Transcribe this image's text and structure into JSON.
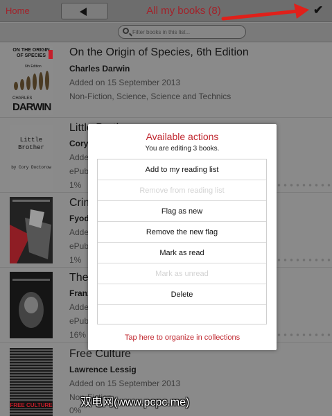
{
  "topbar": {
    "home_label": "Home",
    "title": "All my books (8)",
    "check_icon": "✔"
  },
  "search": {
    "placeholder": "Filter books in this list..."
  },
  "books": [
    {
      "title": "On the Origin of Species, 6th Edition",
      "author": "Charles Darwin",
      "added": "Added on 15 September 2013",
      "meta": "Non-Fiction, Science, Science and Technics",
      "cover_title": "ON THE ORIGIN OF SPECIES",
      "cover_edition": "6th Edition",
      "cover_name_small": "CHARLES",
      "cover_name_big": "DARWIN"
    },
    {
      "title": "Little Brother",
      "author": "Cory Doctorow",
      "added": "Added on 15 September 2013",
      "meta": "ePub",
      "progress": "1%",
      "cover_title": "Little Brother",
      "cover_by": "by Cory Doctorow"
    },
    {
      "title": "Crime and Punishment",
      "author": "Fyodor Dostoyevsky",
      "added": "Added on 15 September 2013",
      "meta": "ePub",
      "progress": "1%"
    },
    {
      "title": "The Metamorphosis",
      "author": "Franz Kafka",
      "added": "Added on 15 September 2013",
      "meta": "ePub",
      "progress": "16%"
    },
    {
      "title": "Free Culture",
      "author": "Lawrence Lessig",
      "added": "Added on 15 September 2013",
      "meta": "Non-Fiction",
      "progress": "0%",
      "cover_title": "FREE CULTURE"
    }
  ],
  "modal": {
    "title": "Available actions",
    "subtitle": "You are editing 3 books.",
    "actions": [
      {
        "label": "Add to my reading list",
        "enabled": true
      },
      {
        "label": "Remove from reading list",
        "enabled": false
      },
      {
        "label": "Flag as new",
        "enabled": true
      },
      {
        "label": "Remove the new flag",
        "enabled": true
      },
      {
        "label": "Mark as read",
        "enabled": true
      },
      {
        "label": "Mark as unread",
        "enabled": false
      },
      {
        "label": "Delete",
        "enabled": true
      },
      {
        "label": "",
        "enabled": false
      }
    ],
    "collections_link": "Tap here to organize in collections"
  },
  "watermark": "双电网(www.pcpc.me)",
  "colors": {
    "accent": "#c0262e",
    "arrow": "#e0201a"
  }
}
